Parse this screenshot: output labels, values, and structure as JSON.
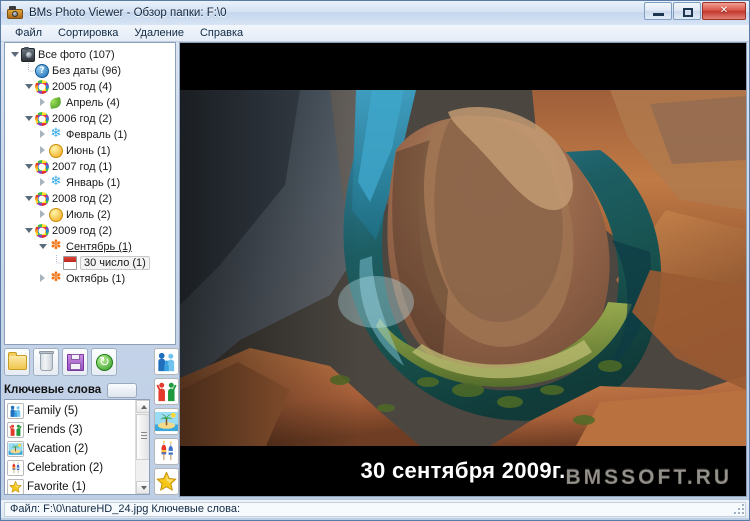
{
  "window": {
    "title": "BMs Photo Viewer - Обзор папки: F:\\0",
    "icon": "camera-icon",
    "controls": {
      "minimize": "minimize-button",
      "maximize": "maximize-button",
      "close_label": "✕"
    }
  },
  "menubar": {
    "items": [
      {
        "label": "Файл"
      },
      {
        "label": "Сортировка"
      },
      {
        "label": "Удаление"
      },
      {
        "label": "Справка"
      }
    ]
  },
  "tree": {
    "nodes": [
      {
        "label": "Все фото (107)",
        "indent": 0,
        "icon": "camera-icon",
        "state": "expanded",
        "hot": false,
        "selected": false
      },
      {
        "label": "Без даты (96)",
        "indent": 1,
        "icon": "question-icon",
        "state": "leaf",
        "hot": false,
        "selected": false
      },
      {
        "label": "2005 год (4)",
        "indent": 1,
        "icon": "ring-icon",
        "state": "expanded",
        "hot": false,
        "selected": false
      },
      {
        "label": "Апрель (4)",
        "indent": 2,
        "icon": "leaf-icon",
        "state": "collapsed",
        "hot": false,
        "selected": false
      },
      {
        "label": "2006 год (2)",
        "indent": 1,
        "icon": "ring-icon",
        "state": "expanded",
        "hot": false,
        "selected": false
      },
      {
        "label": "Февраль (1)",
        "indent": 2,
        "icon": "snowflake-icon",
        "state": "collapsed",
        "hot": false,
        "selected": false
      },
      {
        "label": "Июнь (1)",
        "indent": 2,
        "icon": "sun-icon",
        "state": "collapsed",
        "hot": false,
        "selected": false
      },
      {
        "label": "2007 год (1)",
        "indent": 1,
        "icon": "ring-icon",
        "state": "expanded",
        "hot": false,
        "selected": false
      },
      {
        "label": "Январь (1)",
        "indent": 2,
        "icon": "snowflake-icon",
        "state": "collapsed",
        "hot": false,
        "selected": false
      },
      {
        "label": "2008 год (2)",
        "indent": 1,
        "icon": "ring-icon",
        "state": "expanded",
        "hot": false,
        "selected": false
      },
      {
        "label": "Июль (2)",
        "indent": 2,
        "icon": "sun-icon",
        "state": "collapsed",
        "hot": false,
        "selected": false
      },
      {
        "label": "2009 год (2)",
        "indent": 1,
        "icon": "ring-icon",
        "state": "expanded",
        "hot": false,
        "selected": false
      },
      {
        "label": "Сентябрь (1)",
        "indent": 2,
        "icon": "maple-icon",
        "state": "expanded",
        "hot": true,
        "selected": false
      },
      {
        "label": "30 число (1)",
        "indent": 3,
        "icon": "calendar-icon",
        "state": "leaf",
        "hot": false,
        "selected": true
      },
      {
        "label": "Октябрь (1)",
        "indent": 2,
        "icon": "maple-icon",
        "state": "collapsed",
        "hot": false,
        "selected": false
      }
    ]
  },
  "toolbar": {
    "buttons": [
      {
        "name": "open-folder-button",
        "icon": "folder-icon"
      },
      {
        "name": "delete-button",
        "icon": "trash-icon"
      },
      {
        "name": "save-button",
        "icon": "floppy-disk-icon"
      },
      {
        "name": "refresh-button",
        "icon": "refresh-icon"
      }
    ]
  },
  "keywords": {
    "header": "Ключевые слова",
    "add_button": "add-keyword-button",
    "items": [
      {
        "label": "Family (5)",
        "icon": "family-icon"
      },
      {
        "label": "Friends (3)",
        "icon": "friends-icon"
      },
      {
        "label": "Vacation (2)",
        "icon": "palm-island-icon"
      },
      {
        "label": "Celebration (2)",
        "icon": "fireworks-icon"
      },
      {
        "label": "Favorite (1)",
        "icon": "star-icon"
      }
    ],
    "side_icons": [
      {
        "name": "family-tag-button",
        "icon": "family-icon"
      },
      {
        "name": "friends-tag-button",
        "icon": "friends-icon"
      },
      {
        "name": "vacation-tag-button",
        "icon": "palm-island-icon"
      },
      {
        "name": "celebration-tag-button",
        "icon": "fireworks-icon"
      },
      {
        "name": "favorite-tag-button",
        "icon": "star-icon"
      }
    ]
  },
  "viewer": {
    "caption": "30 сентября 2009г.",
    "watermark": "BMSSOFT.RU",
    "photo_alt": "horseshoe-bend-canyon-photo"
  },
  "statusbar": {
    "text": "Файл: F:\\0\\natureHD_24.jpg Ключевые слова:"
  },
  "colors": {
    "accent": "#2f7fd0",
    "close_red": "#c3372d",
    "window_bg": "#cbd9ec",
    "photo_bg": "#000000"
  }
}
